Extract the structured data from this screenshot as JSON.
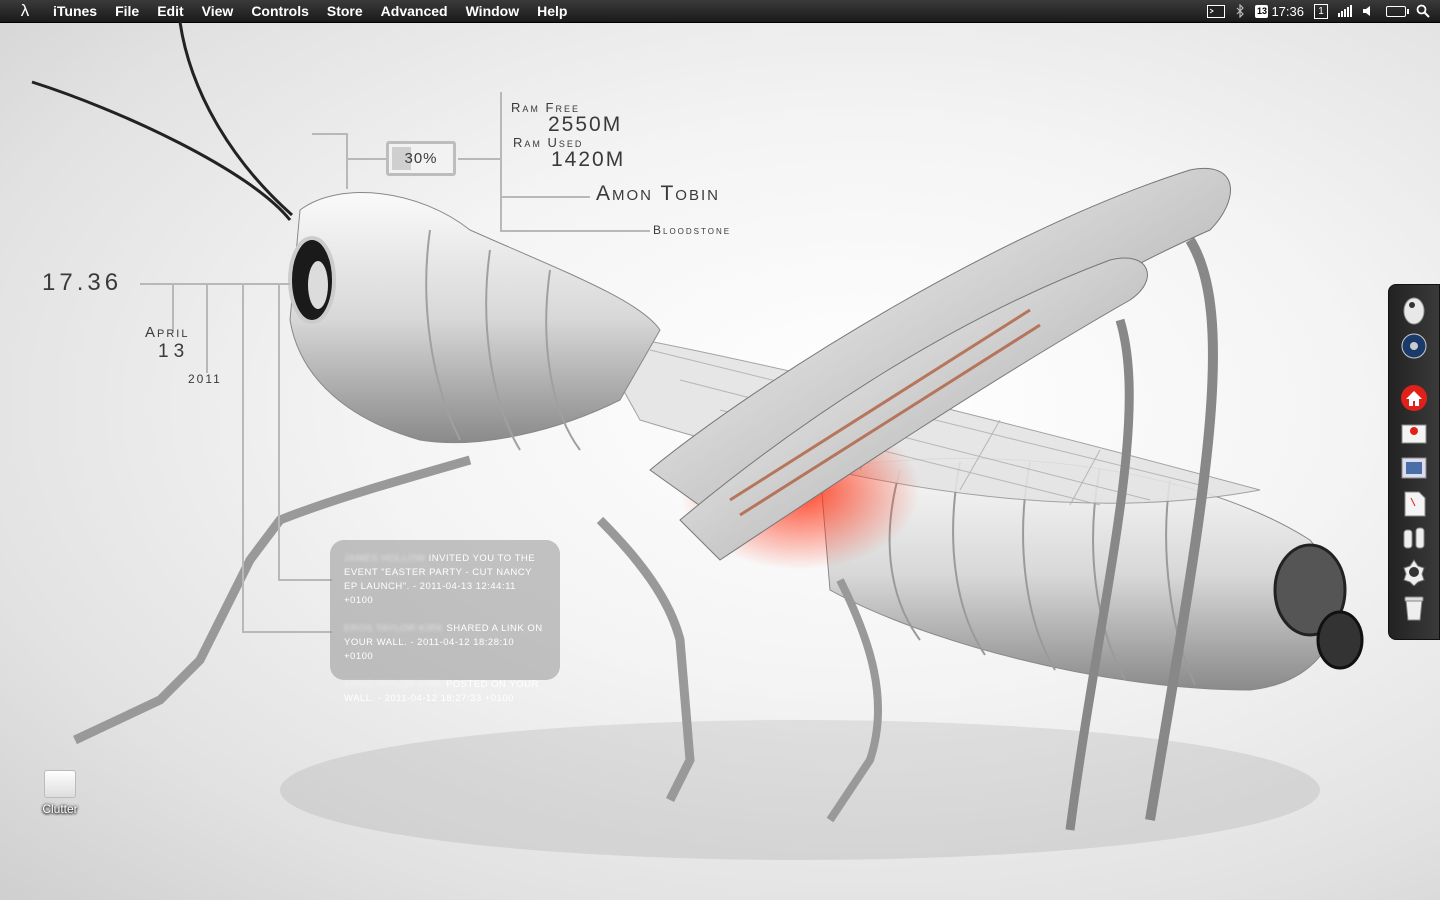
{
  "menubar": {
    "app": "iTunes",
    "items": [
      "File",
      "Edit",
      "View",
      "Controls",
      "Store",
      "Advanced",
      "Window",
      "Help"
    ],
    "calendar_day": "13",
    "clock": "17:36",
    "space_number": "1",
    "icons": [
      "lambda-icon",
      "terminal-icon",
      "bluetooth-icon",
      "calendar-icon",
      "spaces-icon",
      "signal-icon",
      "volume-icon",
      "battery-icon",
      "spotlight-icon"
    ]
  },
  "widget": {
    "battery": "30%",
    "ram_free_label": "Ram Free",
    "ram_free_value": "2550M",
    "ram_used_label": "Ram Used",
    "ram_used_value": "1420M",
    "artist": "Amon Tobin",
    "track": "Bloodstone",
    "time": "17.36",
    "month": "April",
    "day": "13",
    "year": "2011"
  },
  "notifications": [
    {
      "name": "James Hollow",
      "text": "invited you to the event \"Easter Party - Cut Nancy EP Launch\". - 2011-04-13 12:44:11 +0100"
    },
    {
      "name": "Eros Taylor-Kirk",
      "text": "shared a link on your wall. - 2011-04-12 18:28:10 +0100"
    },
    {
      "name": "Eros Taylor Kirk",
      "text": "posted on your wall. - 2011-04-12 18:27:33 +0100"
    }
  ],
  "dock": {
    "icons": [
      "finder-icon",
      "itunes-icon",
      "home-icon",
      "downloads-icon",
      "preview-icon",
      "document-icon",
      "utilities-icon",
      "settings-icon",
      "trash-icon"
    ]
  },
  "desktop": {
    "icon_label": "Clutter"
  },
  "colors": {
    "accent_red": "#e0201a",
    "text_dark": "#3a3a3a"
  }
}
